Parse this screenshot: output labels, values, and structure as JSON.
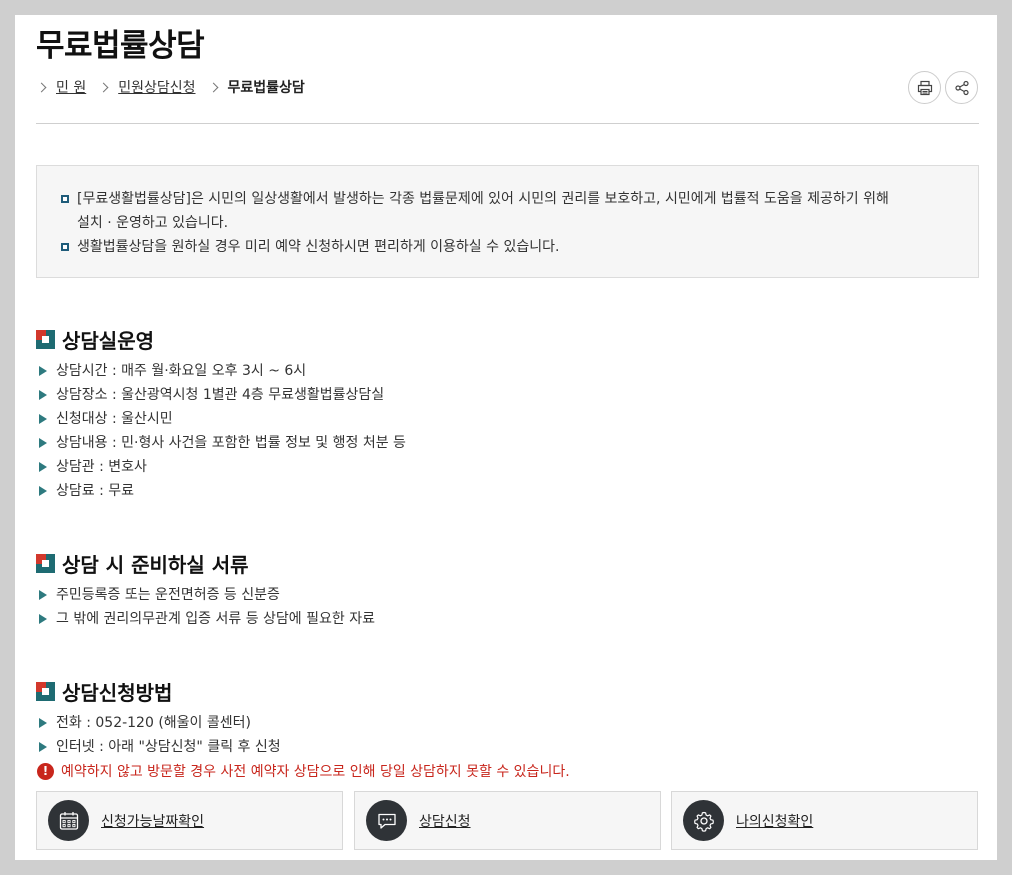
{
  "page": {
    "title": "무료법률상담"
  },
  "breadcrumb": [
    {
      "label": "민 원"
    },
    {
      "label": "민원상담신청"
    },
    {
      "label": "무료법률상담"
    }
  ],
  "tools": {
    "print_icon": "print-icon",
    "share_icon": "share-icon"
  },
  "intro": [
    {
      "line1": "[무료생활법률상담]은 시민의 일상생활에서 발생하는 각종 법률문제에 있어 시민의 권리를 보호하고, 시민에게 법률적 도움을 제공하기 위해",
      "line2": "설치 · 운영하고 있습니다."
    },
    {
      "line1": "생활법률상담을 원하실 경우 미리 예약 신청하시면 편리하게 이용하실 수 있습니다."
    }
  ],
  "sections": [
    {
      "title": "상담실운영",
      "items": [
        "상담시간 : 매주 월·화요일 오후 3시 ~ 6시",
        "상담장소 : 울산광역시청 1별관 4층 무료생활법률상담실",
        "신청대상 : 울산시민",
        "상담내용 : 민·형사 사건을 포함한 법률 정보 및 행정 처분 등",
        "상담관 : 변호사",
        "상담료 : 무료"
      ]
    },
    {
      "title": "상담 시 준비하실 서류",
      "items": [
        "주민등록증 또는 운전면허증 등 신분증",
        "그 밖에 권리의무관계 입증 서류 등 상담에 필요한 자료"
      ]
    },
    {
      "title": "상담신청방법",
      "items": [
        "전화 : 052-120 (해울이 콜센터)",
        "인터넷 : 아래 \"상담신청\" 클릭 후 신청"
      ]
    }
  ],
  "warning": {
    "icon": "!",
    "text": "예약하지 않고 방문할 경우 사전 예약자 상담으로 인해 당일 상담하지 못할 수 있습니다."
  },
  "actions": [
    {
      "label": "신청가능날짜확인",
      "icon": "calendar-icon"
    },
    {
      "label": "상담신청",
      "icon": "chat-icon"
    },
    {
      "label": "나의신청확인",
      "icon": "gear-icon"
    }
  ],
  "colors": {
    "accent_teal": "#1e6b72",
    "accent_red": "#d2382c",
    "warning_red": "#c8261c",
    "dark_circle": "#2f3337"
  }
}
